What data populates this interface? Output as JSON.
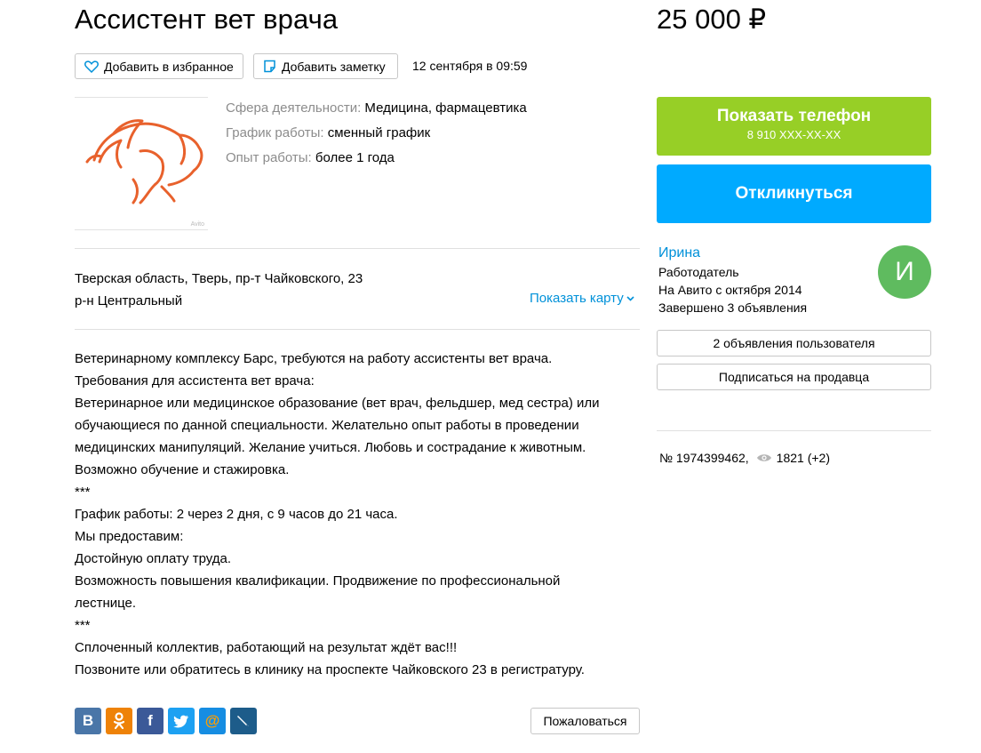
{
  "listing": {
    "title": "Ассистент вет врача",
    "price": "25 000 ₽",
    "date": "12 сентября в 09:59"
  },
  "toolbar": {
    "favorite_label": "Добавить в избранное",
    "note_label": "Добавить заметку"
  },
  "params": [
    {
      "label": "Сфера деятельности:",
      "value": "Медицина, фармацевтика"
    },
    {
      "label": "График работы:",
      "value": "сменный график"
    },
    {
      "label": "Опыт работы:",
      "value": "более 1 года"
    }
  ],
  "photo": {
    "watermark": "Avito"
  },
  "location": {
    "address": "Тверская область, Тверь, пр-т Чайковского, 23",
    "district": "р-н Центральный",
    "show_map": "Показать карту"
  },
  "description": [
    "Ветеринарному комплексу Барс, требуются на работу ассистенты вет врача.",
    "Требования для ассистента вет врача:",
    "Ветеринарное или медицинское образование (вет врач, фельдшер, мед сестра) или обучающиеся по данной специальности. Желательно опыт работы в проведении медицинских манипуляций. Желание учиться. Любовь и сострадание к животным.",
    "Возможно обучение и стажировка.",
    "***",
    "График работы: 2 через 2 дня, с 9 часов до 21 часа.",
    "Мы предоставим:",
    "Достойную оплату труда.",
    "Возможность повышения квалификации. Продвижение по профессиональной лестнице.",
    "***",
    "Сплоченный коллектив, работающий на результат ждёт вас!!!",
    "Позвоните или обратитесь в клинику на проспекте Чайковского 23 в регистратуру."
  ],
  "share": {
    "vk": "В",
    "ok": "ok",
    "fb": "f",
    "tw": "t",
    "mm": "@",
    "lj": "lj"
  },
  "complain_label": "Пожаловаться",
  "contact": {
    "phone_label": "Показать телефон",
    "phone_masked": "8 910 XXX-XX-XX",
    "respond_label": "Откликнуться"
  },
  "seller": {
    "name": "Ирина",
    "role": "Работодатель",
    "since": "На Авито с октября 2014",
    "completed": "Завершено 3 объявления",
    "avatar_letter": "И",
    "avatar_color": "#5fbb5f"
  },
  "seller_actions": {
    "ads_label": "2 объявления пользователя",
    "subscribe_label": "Подписаться на продавца"
  },
  "meta": {
    "item_number": "№ 1974399462,",
    "views": "1821 (+2)"
  },
  "colors": {
    "phone_button": "#97cf26",
    "respond_button": "#00aaff",
    "link": "#0091d9",
    "logo": "#e8612c"
  }
}
